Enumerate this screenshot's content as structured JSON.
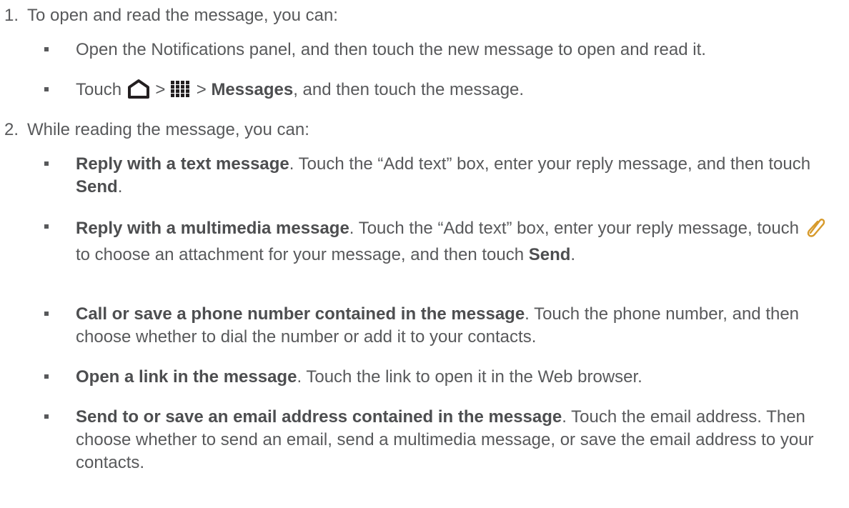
{
  "step1": {
    "number": "1.",
    "text": "To open and read the message, you can:",
    "bullets": {
      "b1": {
        "text": "Open the Notifications panel, and then touch the new message to open and read it."
      },
      "b2": {
        "pre": "Touch ",
        "sep1": " > ",
        "sep2": " > ",
        "bold": "Messages",
        "post": ", and then touch the message.",
        "icons": [
          "home-icon",
          "apps-grid-icon"
        ]
      }
    }
  },
  "step2": {
    "number": "2.",
    "text": "While reading the message, you can:",
    "bullets": {
      "b1": {
        "bold": "Reply with a text message",
        "mid": ". Touch the “Add text” box, enter your reply message, and then touch ",
        "bold2": "Send",
        "end": "."
      },
      "b2": {
        "bold": "Reply with a multimedia message",
        "mid": ". Touch the “Add text” box, enter your reply message, touch ",
        "icon": "paperclip-icon",
        "mid2": " to choose an attachment for your message, and then touch ",
        "bold2": "Send",
        "end": "."
      },
      "b3": {
        "bold": "Call or save a phone number contained in the message",
        "text": ". Touch the phone number, and then choose whether to dial the number or add it to your contacts."
      },
      "b4": {
        "bold": "Open a link in the message",
        "text": ". Touch the link to open it in the Web browser."
      },
      "b5": {
        "bold": "Send to or save an email address contained in the message",
        "text": ". Touch the email address. Then choose whether to send an email, send a multimedia message, or save the email address to your contacts."
      }
    }
  },
  "colors": {
    "text": "#58595b",
    "icon": "#231f20"
  }
}
